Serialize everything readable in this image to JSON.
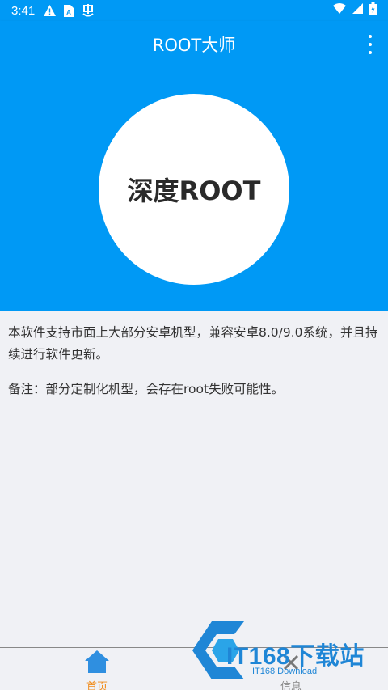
{
  "status_bar": {
    "time": "3:41",
    "icons": [
      "warning-icon",
      "sim-card-icon",
      "app-notification-icon"
    ],
    "right_icons": [
      "wifi-icon",
      "signal-icon",
      "battery-icon"
    ]
  },
  "app_bar": {
    "title": "ROOT大师",
    "menu_icon": "more-vert-icon"
  },
  "hero": {
    "button_label": "深度ROOT"
  },
  "content": {
    "description": "本软件支持市面上大部分安卓机型，兼容安卓8.0/9.0系统，并且持续进行软件更新。",
    "note": "备注：部分定制化机型，会存在root失败可能性。"
  },
  "bottom_nav": {
    "items": [
      {
        "label": "首页",
        "icon": "home-icon",
        "active": true
      },
      {
        "label": "信息",
        "icon": "info-icon",
        "active": false
      }
    ]
  },
  "watermark": {
    "text": "IT168下载站",
    "sub": "IT168 Download"
  },
  "colors": {
    "primary": "#0099f5",
    "active_tab": "#f08a18",
    "background": "#f0f1f5"
  }
}
